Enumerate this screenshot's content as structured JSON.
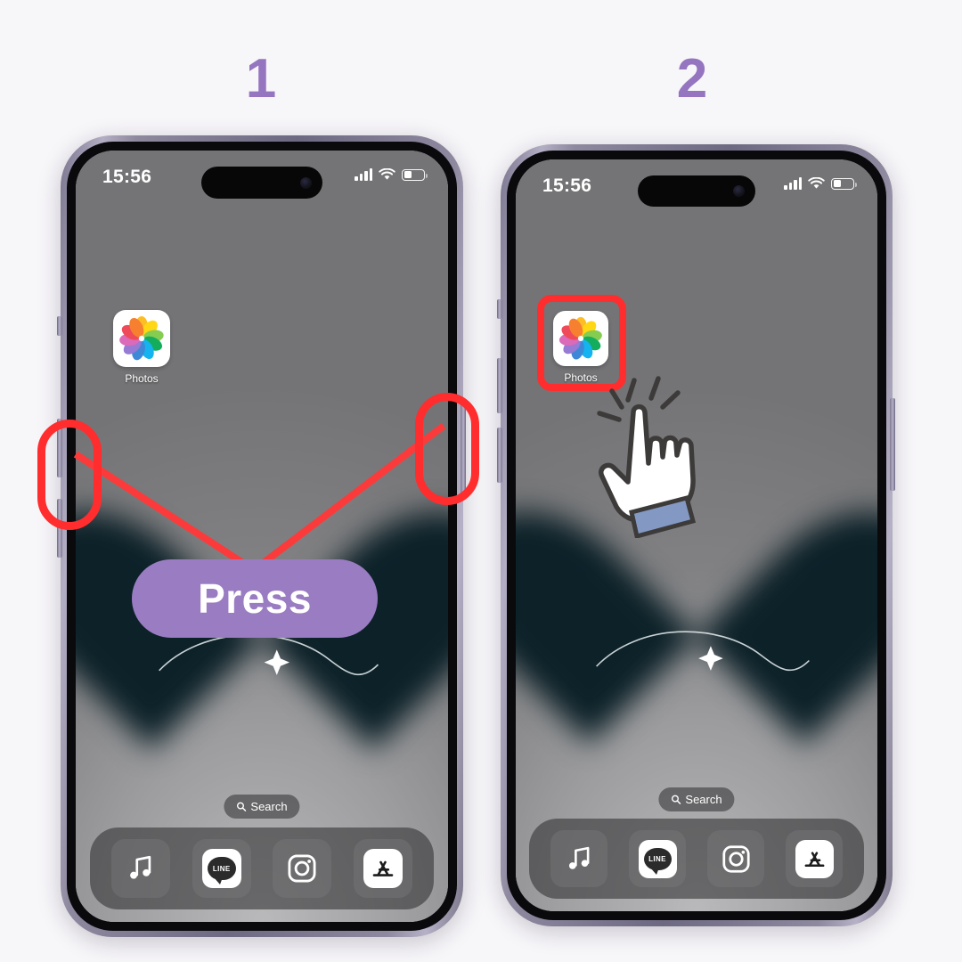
{
  "steps": [
    {
      "number": "1",
      "label_icon": "step-number"
    },
    {
      "number": "2",
      "label_icon": "step-number"
    }
  ],
  "accent": {
    "step_number_color": "#9575c0",
    "highlight_color": "#ff2d2d",
    "press_button_color": "#9a7cc2",
    "page_background": "#f7f6f9"
  },
  "phone1": {
    "status_bar": {
      "time": "15:56",
      "cellular_icon": "signal-bars-icon",
      "wifi_icon": "wifi-icon",
      "battery_icon": "battery-icon"
    },
    "home_screen": {
      "app": {
        "name": "Photos",
        "icon": "photos-icon"
      },
      "search": {
        "label": "Search",
        "icon": "search-icon"
      },
      "dock": [
        {
          "name": "Music",
          "icon": "music-note-icon"
        },
        {
          "name": "LINE",
          "icon": "line-icon",
          "glyph": "LINE"
        },
        {
          "name": "Instagram",
          "icon": "instagram-icon"
        },
        {
          "name": "App Store",
          "icon": "app-store-icon"
        }
      ]
    },
    "annotations": {
      "volume_button_highlight": "red-oval-left-side-button",
      "side_button_highlight": "red-oval-right-side-button",
      "connector": "red-v-lines",
      "action_button_label": "Press"
    }
  },
  "phone2": {
    "status_bar": {
      "time": "15:56",
      "cellular_icon": "signal-bars-icon",
      "wifi_icon": "wifi-icon",
      "battery_icon": "battery-icon"
    },
    "home_screen": {
      "app": {
        "name": "Photos",
        "icon": "photos-icon"
      },
      "search": {
        "label": "Search",
        "icon": "search-icon"
      },
      "dock": [
        {
          "name": "Music",
          "icon": "music-note-icon"
        },
        {
          "name": "LINE",
          "icon": "line-icon",
          "glyph": "LINE"
        },
        {
          "name": "Instagram",
          "icon": "instagram-icon"
        },
        {
          "name": "App Store",
          "icon": "app-store-icon"
        }
      ]
    },
    "annotations": {
      "app_highlight": "red-rounded-box-around-photos",
      "cursor": "tap-hand-cursor"
    }
  }
}
